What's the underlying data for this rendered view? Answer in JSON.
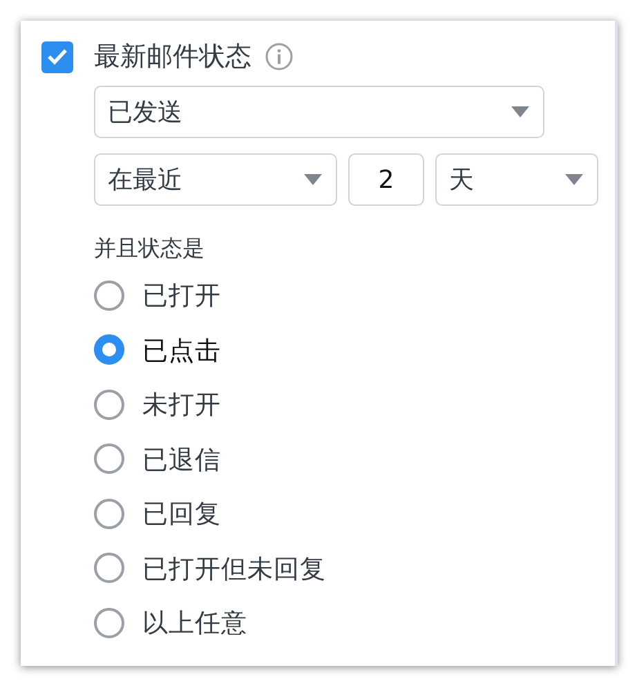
{
  "filter": {
    "checked": true,
    "title": "最新邮件状态",
    "status_select": {
      "value": "已发送"
    },
    "range_select": {
      "value": "在最近"
    },
    "count_field": {
      "value": "2"
    },
    "unit_select": {
      "value": "天"
    },
    "status_label": "并且状态是",
    "options": [
      {
        "label": "已打开",
        "selected": false
      },
      {
        "label": "已点击",
        "selected": true
      },
      {
        "label": "未打开",
        "selected": false
      },
      {
        "label": "已退信",
        "selected": false
      },
      {
        "label": "已回复",
        "selected": false
      },
      {
        "label": "已打开但未回复",
        "selected": false
      },
      {
        "label": "以上任意",
        "selected": false
      }
    ]
  }
}
